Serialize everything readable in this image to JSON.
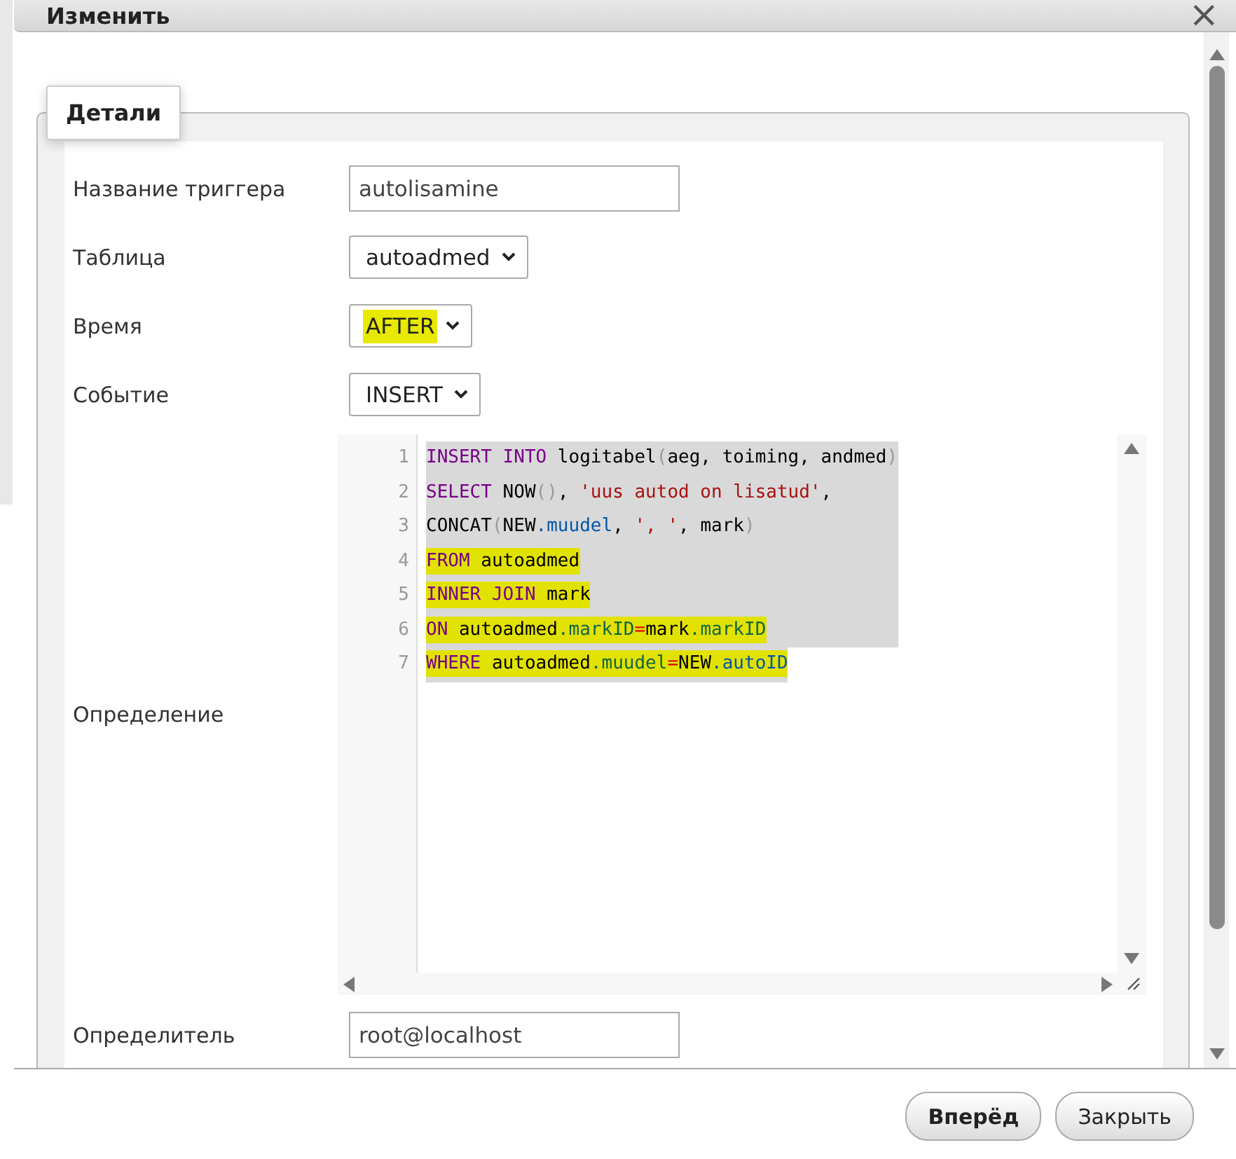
{
  "window": {
    "title": "Изменить",
    "close": "×"
  },
  "tab": {
    "label": "Детали"
  },
  "fields": [
    {
      "kind": "text",
      "label": "Название триггера",
      "value": "autolisamine",
      "highlighted": false
    },
    {
      "kind": "select",
      "label": "Таблица",
      "value": "autoadmed",
      "highlighted": false
    },
    {
      "kind": "select",
      "label": "Время",
      "value": "AFTER",
      "highlighted": true
    },
    {
      "kind": "select",
      "label": "Событие",
      "value": "INSERT",
      "highlighted": false
    },
    {
      "kind": "code",
      "label": "Определение",
      "lines": [
        {
          "number": "1",
          "selected": true,
          "highlighted": false,
          "tokens": [
            {
              "kind": "keyword",
              "text": "INSERT INTO"
            },
            {
              "kind": "plain",
              "text": " logitabel"
            },
            {
              "kind": "bracket",
              "text": "("
            },
            {
              "kind": "plain",
              "text": "aeg, toiming, andmed"
            },
            {
              "kind": "bracket",
              "text": ")"
            }
          ]
        },
        {
          "number": "2",
          "selected": true,
          "highlighted": false,
          "tokens": [
            {
              "kind": "keyword",
              "text": "SELECT"
            },
            {
              "kind": "plain",
              "text": " NOW"
            },
            {
              "kind": "bracket",
              "text": "()"
            },
            {
              "kind": "plain",
              "text": ", "
            },
            {
              "kind": "string",
              "text": "'uus autod on lisatud'"
            },
            {
              "kind": "plain",
              "text": ","
            }
          ]
        },
        {
          "number": "3",
          "selected": true,
          "highlighted": false,
          "tokens": [
            {
              "kind": "plain",
              "text": "CONCAT"
            },
            {
              "kind": "bracket",
              "text": "("
            },
            {
              "kind": "plain",
              "text": "NEW"
            },
            {
              "kind": "property",
              "text": ".muudel"
            },
            {
              "kind": "plain",
              "text": ", "
            },
            {
              "kind": "string",
              "text": "', '"
            },
            {
              "kind": "plain",
              "text": ", mark"
            },
            {
              "kind": "bracket",
              "text": ")"
            }
          ]
        },
        {
          "number": "4",
          "selected": true,
          "highlighted": true,
          "tokens": [
            {
              "kind": "keyword",
              "text": "FROM"
            },
            {
              "kind": "plain",
              "text": " autoadmed"
            }
          ]
        },
        {
          "number": "5",
          "selected": true,
          "highlighted": true,
          "tokens": [
            {
              "kind": "keyword",
              "text": "INNER JOIN"
            },
            {
              "kind": "plain",
              "text": " mark"
            }
          ]
        },
        {
          "number": "6",
          "selected": true,
          "highlighted": true,
          "tokens": [
            {
              "kind": "keyword",
              "text": "ON"
            },
            {
              "kind": "plain",
              "text": " autoadmed"
            },
            {
              "kind": "variable",
              "text": ".markID"
            },
            {
              "kind": "operator",
              "text": "="
            },
            {
              "kind": "plain",
              "text": "mark"
            },
            {
              "kind": "variable",
              "text": ".markID"
            }
          ]
        },
        {
          "number": "7",
          "selected": true,
          "highlighted": true,
          "tokens": [
            {
              "kind": "keyword",
              "text": "WHERE"
            },
            {
              "kind": "plain",
              "text": " autoadmed"
            },
            {
              "kind": "variable",
              "text": ".muudel"
            },
            {
              "kind": "operator",
              "text": "="
            },
            {
              "kind": "plain",
              "text": "NEW"
            },
            {
              "kind": "property",
              "text": ".autoID"
            }
          ]
        }
      ]
    },
    {
      "kind": "text",
      "label": "Определитель",
      "value": "root@localhost",
      "highlighted": false
    }
  ],
  "buttons": [
    {
      "label": "Вперёд",
      "primary": true
    },
    {
      "label": "Закрыть",
      "primary": false
    }
  ]
}
